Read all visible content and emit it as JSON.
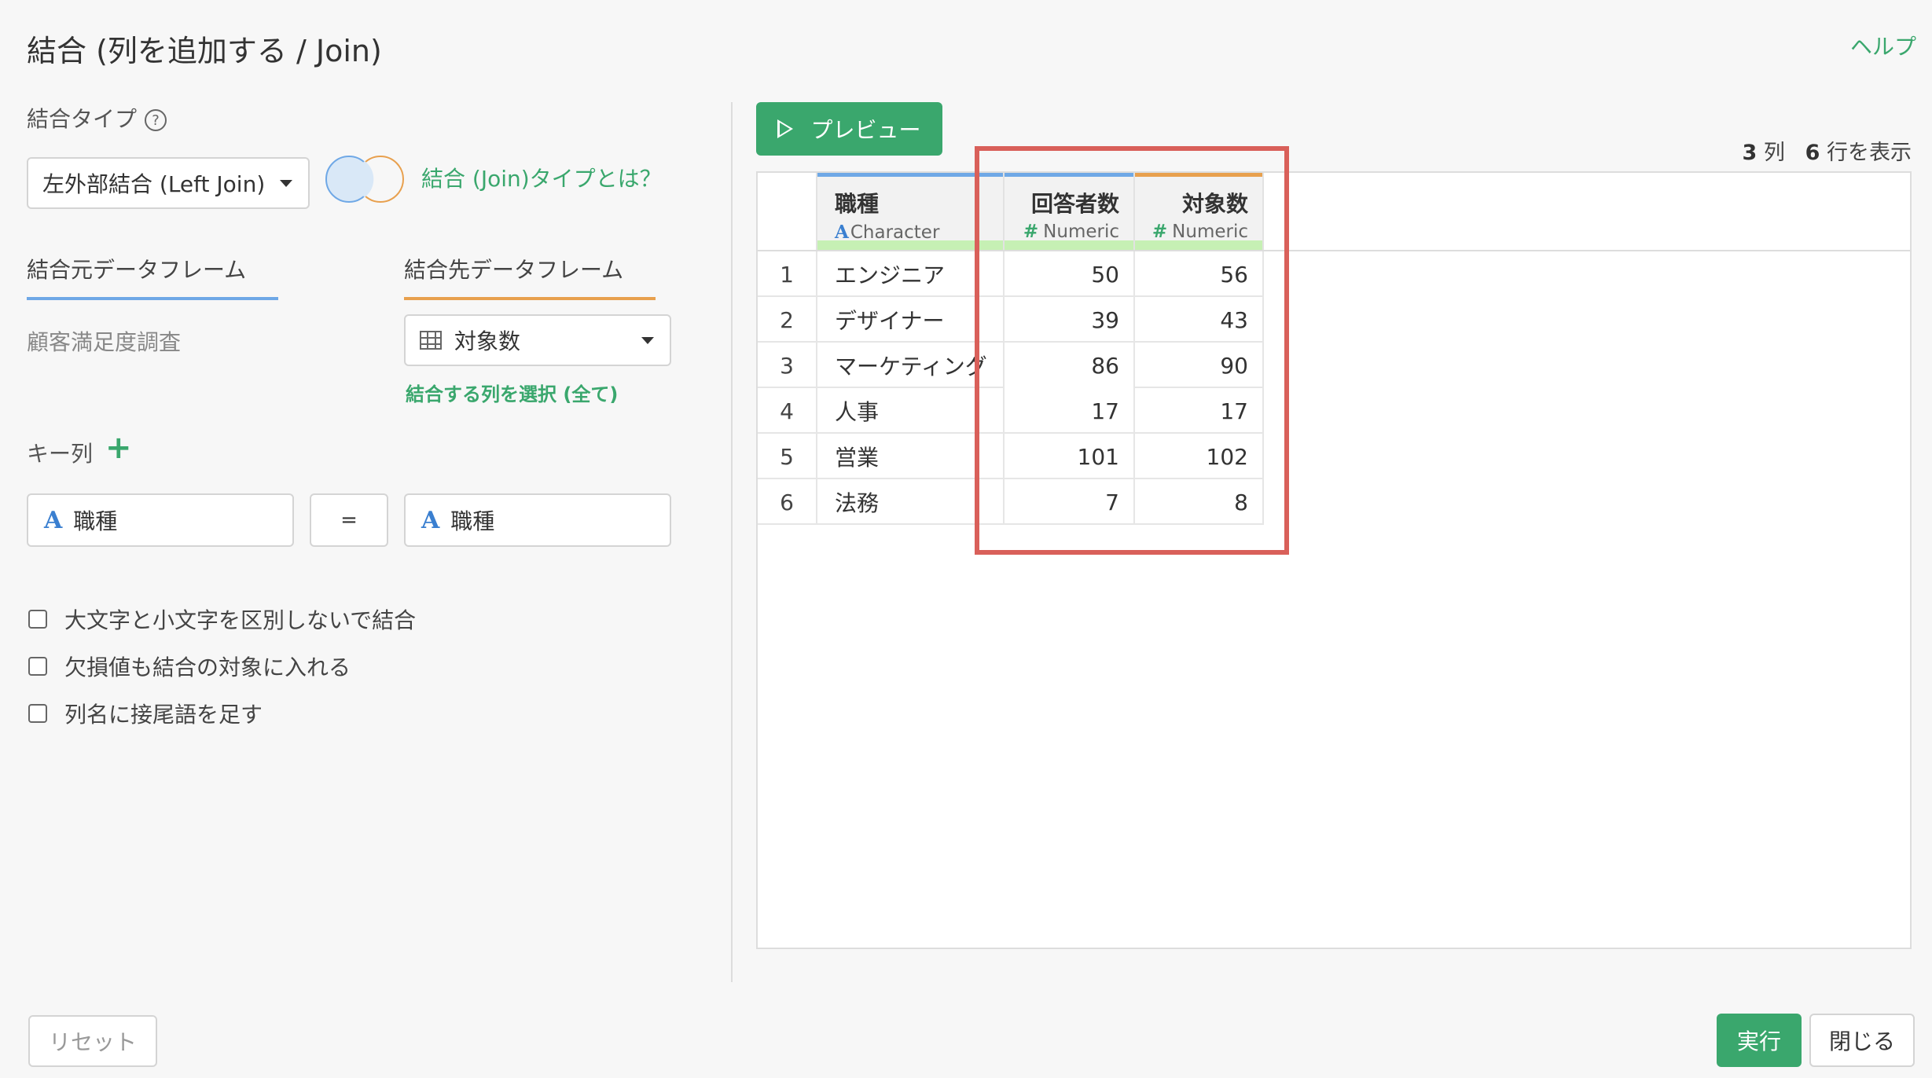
{
  "dialog": {
    "title": "結合 (列を追加する / Join)",
    "help_link": "ヘルプ"
  },
  "join_type": {
    "label": "結合タイプ",
    "help_icon": "question-circle-icon",
    "selected": "左外部結合 (Left Join)",
    "what_is_link": "結合 (Join)タイプとは？"
  },
  "tabs": {
    "source": "結合元データフレーム",
    "target": "結合先データフレーム"
  },
  "source_dataframe": "顧客満足度調査",
  "target_dataframe": {
    "selected": "対象数",
    "select_columns_link": "結合する列を選択 (全て)"
  },
  "key_columns": {
    "label": "キー列",
    "left": "職種",
    "operator": "=",
    "right": "職種"
  },
  "options": [
    {
      "label": "大文字と小文字を区別しないで結合",
      "checked": false
    },
    {
      "label": "欠損値も結合の対象に入れる",
      "checked": false
    },
    {
      "label": "列名に接尾語を足す",
      "checked": false
    }
  ],
  "preview": {
    "button_label": "プレビュー",
    "col_count": "3",
    "col_unit": "列",
    "row_count": "6",
    "row_unit": "行を表示"
  },
  "table": {
    "columns": [
      {
        "name": "職種",
        "type": "Character",
        "accent": "#6fa8e6"
      },
      {
        "name": "回答者数",
        "type": "Numeric",
        "accent": "#6fa8e6"
      },
      {
        "name": "対象数",
        "type": "Numeric",
        "accent": "#e8a04e"
      }
    ],
    "rows": [
      {
        "idx": "1",
        "job": "エンジニア",
        "respondents": "50",
        "targets": "56"
      },
      {
        "idx": "2",
        "job": "デザイナー",
        "respondents": "39",
        "targets": "43"
      },
      {
        "idx": "3",
        "job": "マーケティング",
        "respondents": "86",
        "targets": "90"
      },
      {
        "idx": "4",
        "job": "人事",
        "respondents": "17",
        "targets": "17"
      },
      {
        "idx": "5",
        "job": "営業",
        "respondents": "101",
        "targets": "102"
      },
      {
        "idx": "6",
        "job": "法務",
        "respondents": "7",
        "targets": "8"
      }
    ]
  },
  "footer": {
    "reset": "リセット",
    "run": "実行",
    "close": "閉じる"
  },
  "colors": {
    "accent_green": "#3aa76d",
    "highlight_red": "#d9605a",
    "source_blue": "#6fa8e6",
    "target_orange": "#e8a04e"
  }
}
